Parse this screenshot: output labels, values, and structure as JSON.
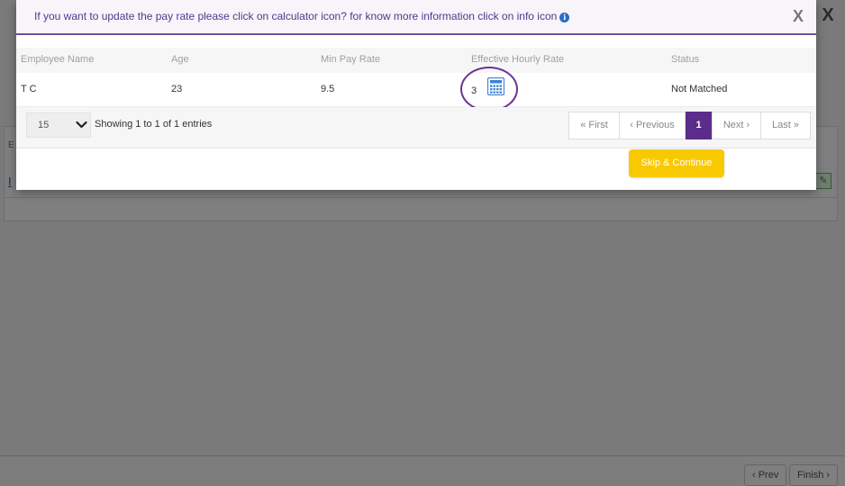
{
  "modal": {
    "message": "If you want to update the pay rate please click on calculator icon? for know more information click on info icon",
    "info_icon": "info-icon",
    "close_icon": "close-icon",
    "close_glyph": "X"
  },
  "table": {
    "columns": [
      "Employee Name",
      "Age",
      "Min Pay Rate",
      "Effective Hourly Rate",
      "Status"
    ],
    "rows": [
      {
        "employee_name": "T C",
        "age": "23",
        "min_pay_rate": "9.5",
        "effective_hourly_rate": "3",
        "status": "Not Matched"
      }
    ],
    "calculator_icon": "calculator-icon"
  },
  "pager": {
    "page_size": "15",
    "showing": "Showing 1 to 1 of 1 entries",
    "first": "« First",
    "previous": "‹ Previous",
    "current": "1",
    "next": "Next ›",
    "last": "Last »"
  },
  "actions": {
    "skip_continue": "Skip & Continue"
  },
  "background": {
    "close_glyph": "X",
    "letter": "E",
    "link": "I",
    "prev": "‹ Prev",
    "finish": "Finish ›"
  },
  "colors": {
    "accent_purple": "#5b2c8b",
    "skip_yellow": "#f9c900",
    "calculator_blue": "#3b82d6"
  }
}
